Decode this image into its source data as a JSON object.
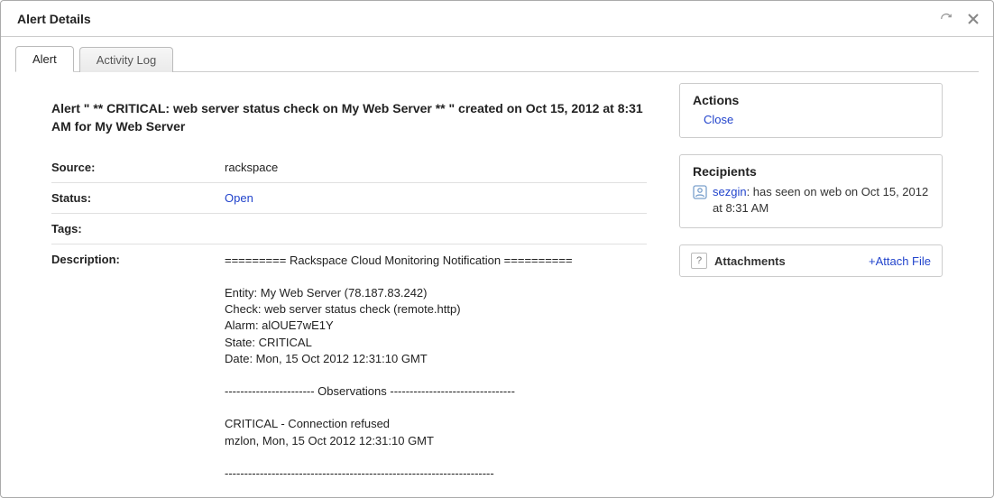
{
  "window": {
    "title": "Alert Details"
  },
  "tabs": [
    {
      "label": "Alert",
      "active": true
    },
    {
      "label": "Activity Log",
      "active": false
    }
  ],
  "alert": {
    "headline": "Alert \" ** CRITICAL: web server status check on My Web Server ** \" created on Oct 15, 2012 at 8:31 AM for My Web Server",
    "fields": {
      "source_label": "Source:",
      "source_value": "rackspace",
      "status_label": "Status:",
      "status_value": "Open",
      "tags_label": "Tags:",
      "tags_value": "",
      "description_label": "Description:",
      "description_value": "========= Rackspace Cloud Monitoring Notification ==========\n\nEntity: My Web Server (78.187.83.242)\nCheck: web server status check (remote.http)\nAlarm: alOUE7wE1Y\nState: CRITICAL\nDate: Mon, 15 Oct 2012 12:31:10 GMT\n\n----------------------- Observations --------------------------------\n\nCRITICAL - Connection refused\nmzlon, Mon, 15 Oct 2012 12:31:10 GMT\n\n---------------------------------------------------------------------"
    }
  },
  "actions": {
    "title": "Actions",
    "close_label": "Close"
  },
  "recipients": {
    "title": "Recipients",
    "items": [
      {
        "name": "sezgin",
        "suffix": ": has seen on web on Oct 15, 2012 at 8:31 AM"
      }
    ]
  },
  "attachments": {
    "help": "?",
    "title": "Attachments",
    "attach_label": "+Attach File"
  }
}
